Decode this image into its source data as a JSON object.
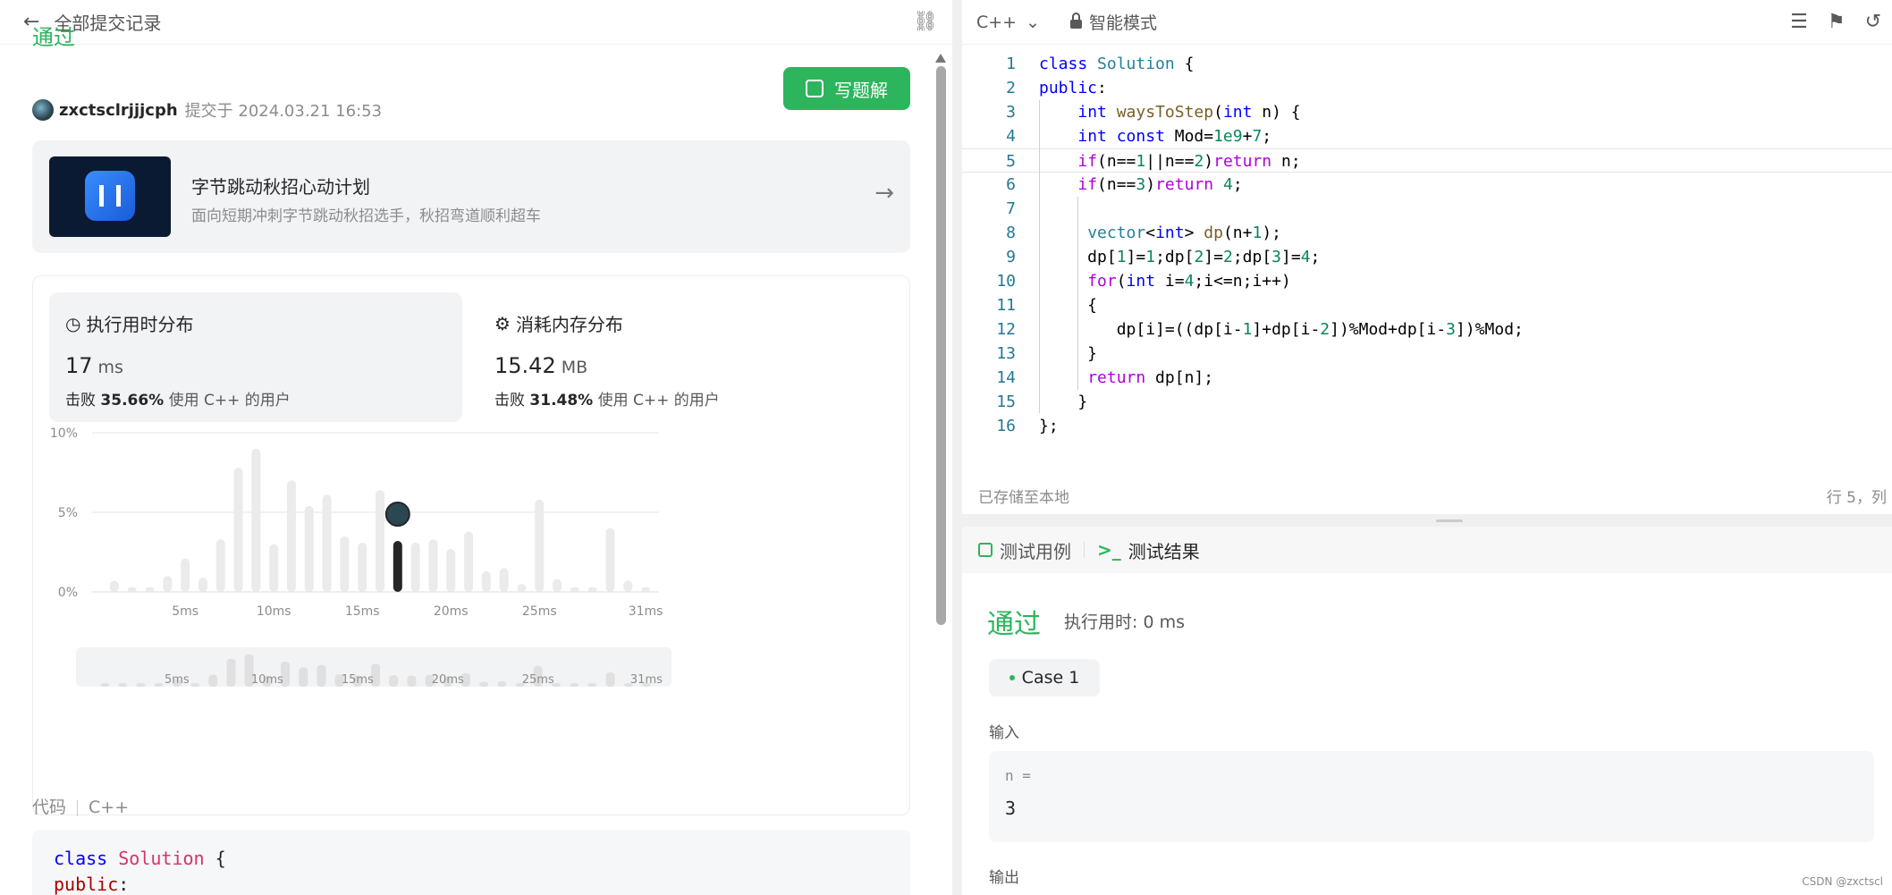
{
  "left": {
    "header_title": "全部提交记录",
    "status": "通过",
    "user": "zxctsclrjjjcph",
    "submitted_at": "提交于 2024.03.21 16:53",
    "write_solution": "写题解",
    "promo": {
      "title": "字节跳动秋招心动计划",
      "subtitle": "面向短期冲刺字节跳动秋招选手，秋招弯道顺利超车"
    },
    "runtime": {
      "label": "执行用时分布",
      "value": "17",
      "unit": "ms",
      "beat_prefix": "击败",
      "beat_pct": "35.66%",
      "beat_suffix": "使用 C++ 的用户"
    },
    "memory": {
      "label": "消耗内存分布",
      "value": "15.42",
      "unit": "MB",
      "beat_prefix": "击败",
      "beat_pct": "31.48%",
      "beat_suffix": "使用 C++ 的用户"
    },
    "code_label": "代码",
    "code_lang": "C++",
    "code_lines": [
      "class Solution {",
      "public:"
    ]
  },
  "chart_data": {
    "type": "bar",
    "title": "",
    "xlabel": "",
    "ylabel": "",
    "y_ticks": [
      "10%",
      "5%",
      "0%"
    ],
    "x_ticks": [
      "5ms",
      "10ms",
      "15ms",
      "20ms",
      "25ms",
      "31ms"
    ],
    "ylim": [
      0,
      10
    ],
    "xlim": [
      0,
      31
    ],
    "highlight_x": 17,
    "x": [
      1,
      2,
      3,
      4,
      5,
      6,
      7,
      8,
      9,
      10,
      11,
      12,
      13,
      14,
      15,
      16,
      17,
      18,
      19,
      20,
      21,
      22,
      23,
      24,
      25,
      26,
      27,
      28,
      29,
      30,
      31
    ],
    "values": [
      0.7,
      0.3,
      0.3,
      1.0,
      2.1,
      0.9,
      3.3,
      7.8,
      9.0,
      3.0,
      7.0,
      5.4,
      6.1,
      3.5,
      3.1,
      6.4,
      3.2,
      3.1,
      3.3,
      2.7,
      3.8,
      1.3,
      1.5,
      0.5,
      5.8,
      0.8,
      0.3,
      0.3,
      4.0,
      0.7,
      0.3
    ],
    "mini_x_ticks": [
      "5ms",
      "10ms",
      "15ms",
      "20ms",
      "25ms",
      "31ms"
    ]
  },
  "editor": {
    "lang": "C++",
    "mode": "智能模式",
    "saved": "已存储至本地",
    "cursor": "行 5，列",
    "lines": [
      "class Solution {",
      "public:",
      "    int waysToStep(int n) {",
      "    int const Mod=1e9+7;",
      "    if(n==1||n==2)return n;",
      "    if(n==3)return 4;",
      "",
      "     vector<int> dp(n+1);",
      "     dp[1]=1;dp[2]=2;dp[3]=4;",
      "     for(int i=4;i<=n;i++)",
      "     {",
      "        dp[i]=((dp[i-1]+dp[i-2])%Mod+dp[i-3])%Mod;",
      "     }",
      "     return dp[n];",
      "    }",
      "};"
    ],
    "line_numbers": [
      "1",
      "2",
      "3",
      "4",
      "5",
      "6",
      "7",
      "8",
      "9",
      "10",
      "11",
      "12",
      "13",
      "14",
      "15",
      "16"
    ]
  },
  "results": {
    "tab_testcase": "测试用例",
    "tab_result": "测试结果",
    "status": "通过",
    "runtime": "执行用时: 0 ms",
    "case": "Case 1",
    "input_label": "输入",
    "input_key": "n =",
    "input_value": "3",
    "output_label": "输出",
    "watermark": "CSDN @zxctscl"
  },
  "colors": {
    "accent": "#2db55d",
    "bar": "#ebebeb",
    "highlight_bar": "#262626"
  }
}
